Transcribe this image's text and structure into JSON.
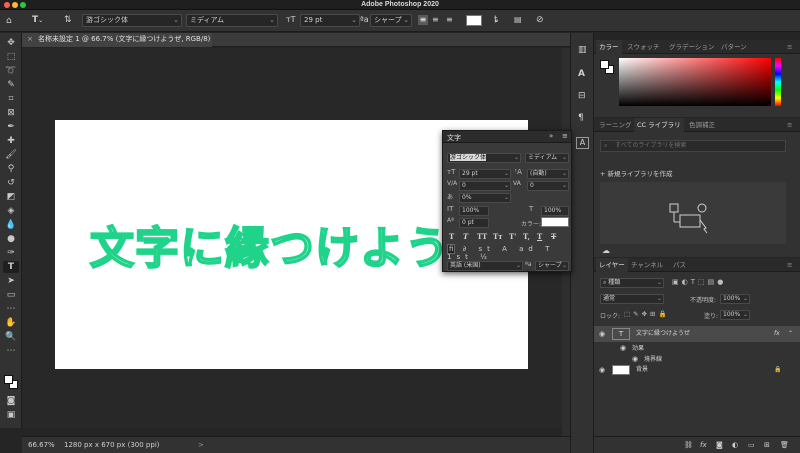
{
  "app": {
    "title": "Adobe Photoshop 2020"
  },
  "options_bar": {
    "font_family": "游ゴシック体",
    "font_style": "ミディアム",
    "font_size": "29 pt",
    "antialias": "シャープ",
    "text_color": "#ffffff"
  },
  "document": {
    "tab_label": "名称未設定 1 @ 66.7% (文字に縁つけようぜ, RGB/8) *",
    "canvas_text": "文字に縁つけようぜ",
    "stroke_color": "#1fd48a"
  },
  "status": {
    "zoom": "66.67%",
    "info": "1280 px x 670 px (300 ppi)"
  },
  "character_panel": {
    "title": "文字",
    "font_family": "游ゴシック体",
    "font_style": "ミディアム",
    "font_size": "29 pt",
    "leading": "(自動)",
    "kerning": "0",
    "tracking": "0",
    "scale_percent": "0%",
    "vertical_scale": "100%",
    "horizontal_scale": "100%",
    "baseline": "0 pt",
    "color_label": "カラー:",
    "style_buttons": [
      "T",
      "T",
      "TT",
      "Tт",
      "T'",
      "T,",
      "T",
      "T"
    ],
    "language": "英語 (米国)",
    "antialias": "シャープ"
  },
  "color_panel": {
    "tabs": [
      "カラー",
      "スウォッチ",
      "グラデーション",
      "パターン"
    ]
  },
  "library_panel": {
    "tabs": [
      "ラーニング",
      "CC ライブラリ",
      "色調補正"
    ],
    "search_placeholder": "すべてのライブラリを検索",
    "create_label": "新規ライブラリを作成"
  },
  "layers_panel": {
    "tabs": [
      "レイヤー",
      "チャンネル",
      "パス"
    ],
    "kind_filter": "種類",
    "blend_mode": "通常",
    "opacity_label": "不透明度:",
    "opacity_value": "100%",
    "lock_label": "ロック:",
    "fill_label": "塗り:",
    "fill_value": "100%",
    "layers": [
      {
        "name": "文字に縁つけようぜ",
        "badge": "fx"
      },
      {
        "name": "効果"
      },
      {
        "name": "境界線"
      },
      {
        "name": "背景"
      }
    ]
  }
}
